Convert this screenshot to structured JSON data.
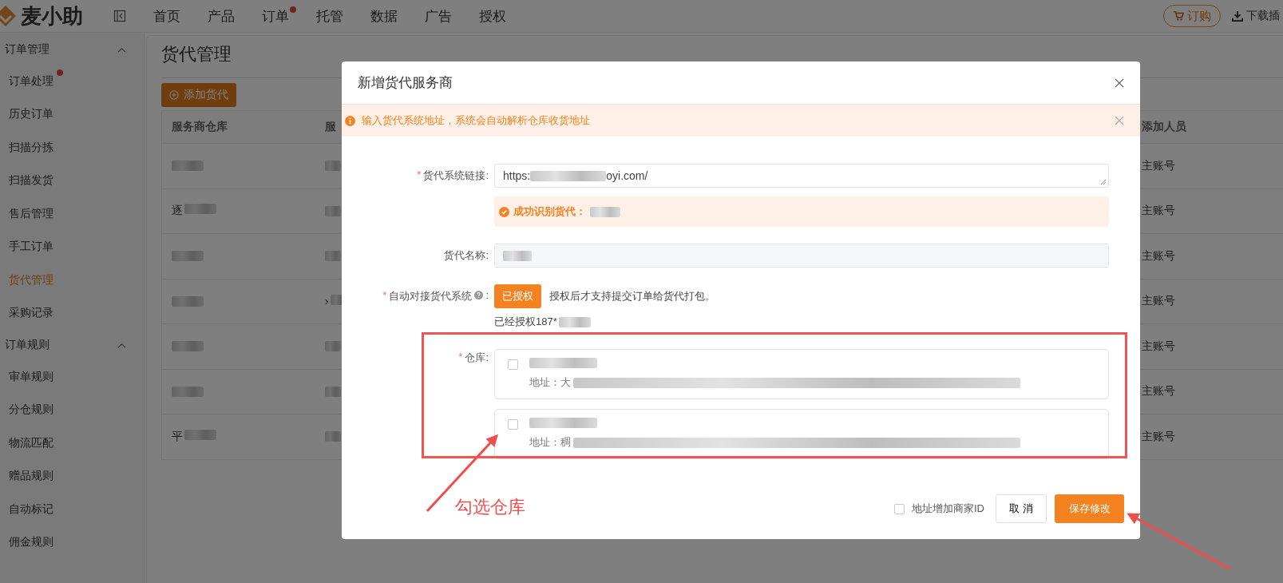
{
  "app": {
    "logo": "麦小助",
    "nav": [
      {
        "label": "首页",
        "badge": false
      },
      {
        "label": "产品",
        "badge": false
      },
      {
        "label": "订单",
        "badge": true
      },
      {
        "label": "托管",
        "badge": false
      },
      {
        "label": "数据",
        "badge": false
      },
      {
        "label": "广告",
        "badge": false
      },
      {
        "label": "授权",
        "badge": false
      }
    ],
    "buy_button": "订购",
    "download": "下载插"
  },
  "sidebar": [
    {
      "title": "订单管理",
      "expanded": true,
      "items": [
        {
          "label": "订单处理",
          "selected": false,
          "badge": true
        },
        {
          "label": "历史订单",
          "selected": false,
          "badge": false
        },
        {
          "label": "扫描分拣",
          "selected": false,
          "badge": false
        },
        {
          "label": "扫描发货",
          "selected": false,
          "badge": false
        },
        {
          "label": "售后管理",
          "selected": false,
          "badge": false
        },
        {
          "label": "手工订单",
          "selected": false,
          "badge": false
        },
        {
          "label": "货代管理",
          "selected": true,
          "badge": false
        },
        {
          "label": "采购记录",
          "selected": false,
          "badge": false
        }
      ]
    },
    {
      "title": "订单规则",
      "expanded": true,
      "items": [
        {
          "label": "审单规则",
          "selected": false,
          "badge": false
        },
        {
          "label": "分仓规则",
          "selected": false,
          "badge": false
        },
        {
          "label": "物流匹配",
          "selected": false,
          "badge": false
        },
        {
          "label": "赠品规则",
          "selected": false,
          "badge": false
        },
        {
          "label": "自动标记",
          "selected": false,
          "badge": false
        },
        {
          "label": "佣金规则",
          "selected": false,
          "badge": false
        }
      ]
    }
  ],
  "page": {
    "title": "货代管理",
    "add_button": "添加货代",
    "table": {
      "columns": [
        "服务商仓库",
        "服",
        "添加人员"
      ],
      "rows": [
        {
          "account": "主账号"
        },
        {
          "warehouse": "逐",
          "account": "主账号"
        },
        {
          "account": "主账号"
        },
        {
          "provider": "›",
          "account": "主账号"
        },
        {
          "account": "主账号"
        },
        {
          "account": "主账号"
        },
        {
          "warehouse": "平",
          "account": "主账号"
        }
      ]
    }
  },
  "dialog": {
    "title": "新增货代服务商",
    "notice": "输入货代系统地址，系统会自动解析仓库收货地址",
    "required_mark": "*",
    "link": {
      "label": "货代系统链接:",
      "required": true,
      "value_start": "https:",
      "value_end": "oyi.com/"
    },
    "success": "成功识别货代：",
    "name": {
      "label": "货代名称:",
      "required": false
    },
    "auth": {
      "label": "自动对接货代系统",
      "label_end": ":",
      "required": true,
      "button": "已授权",
      "hint": "授权后才支持提交订单给货代打包。",
      "status": "已经授权187*"
    },
    "warehouse": {
      "label": "仓库:",
      "required": true,
      "options": [
        {
          "checked": false,
          "address": "地址：大"
        },
        {
          "checked": false,
          "address": "地址：稠"
        }
      ]
    },
    "merchant_id": {
      "label": "地址增加商家ID",
      "checked": false
    },
    "cancel": "取 消",
    "save": "保存修改"
  },
  "annotations": [
    {
      "text": "勾选仓库"
    }
  ]
}
